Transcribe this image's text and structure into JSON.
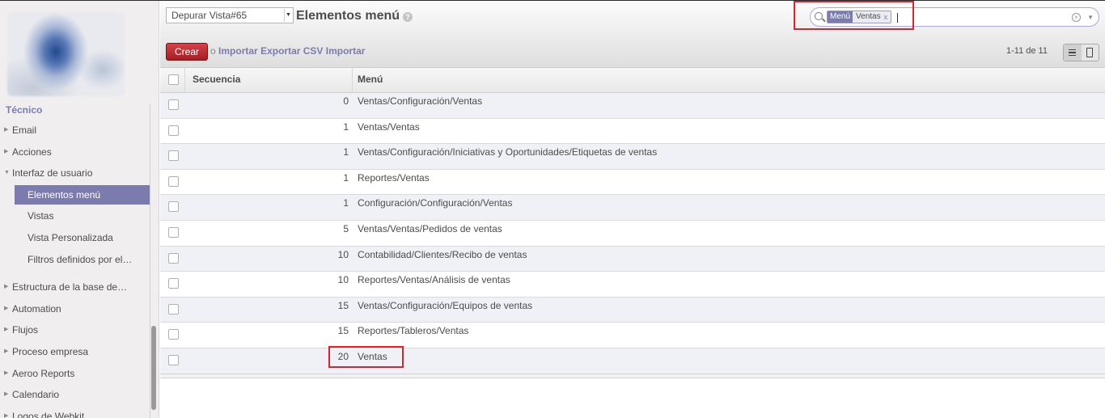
{
  "sidebar": {
    "section_title": "Técnico",
    "items": [
      {
        "label": "Email",
        "level": 0,
        "expanded": false,
        "active": false
      },
      {
        "label": "Acciones",
        "level": 0,
        "expanded": false,
        "active": false
      },
      {
        "label": "Interfaz de usuario",
        "level": 0,
        "expanded": true,
        "active": false
      },
      {
        "label": "Elementos menú",
        "level": 1,
        "expanded": false,
        "active": true
      },
      {
        "label": "Vistas",
        "level": 1,
        "expanded": false,
        "active": false
      },
      {
        "label": "Vista Personalizada",
        "level": 1,
        "expanded": false,
        "active": false
      },
      {
        "label": "Filtros definidos por el…",
        "level": 1,
        "expanded": false,
        "active": false
      },
      {
        "label": "Estructura de la base de…",
        "level": 0,
        "expanded": false,
        "active": false
      },
      {
        "label": "Automation",
        "level": 0,
        "expanded": false,
        "active": false
      },
      {
        "label": "Flujos",
        "level": 0,
        "expanded": false,
        "active": false
      },
      {
        "label": "Proceso empresa",
        "level": 0,
        "expanded": false,
        "active": false
      },
      {
        "label": "Aeroo Reports",
        "level": 0,
        "expanded": false,
        "active": false
      },
      {
        "label": "Calendario",
        "level": 0,
        "expanded": false,
        "active": false
      },
      {
        "label": "Logos de Webkit",
        "level": 0,
        "expanded": false,
        "active": false
      }
    ]
  },
  "header": {
    "debug_select": "Depurar Vista#65",
    "title": "Elementos menú",
    "help": "?",
    "search": {
      "facet_category": "Menú",
      "facet_value": "Ventas",
      "facet_close": "x",
      "clear": "×",
      "drawer": "▼"
    },
    "create_label": "Crear",
    "or_label": "o",
    "links": [
      "Importar",
      "Exportar CSV",
      "Importar"
    ],
    "pager": "1-11 de 11"
  },
  "table": {
    "headers": {
      "sequence": "Secuencia",
      "menu": "Menú"
    },
    "rows": [
      {
        "sequence": "0",
        "menu": "Ventas/Configuración/Ventas"
      },
      {
        "sequence": "1",
        "menu": "Ventas/Ventas"
      },
      {
        "sequence": "1",
        "menu": "Ventas/Configuración/Iniciativas y Oportunidades/Etiquetas de ventas"
      },
      {
        "sequence": "1",
        "menu": "Reportes/Ventas"
      },
      {
        "sequence": "1",
        "menu": "Configuración/Configuración/Ventas"
      },
      {
        "sequence": "5",
        "menu": "Ventas/Ventas/Pedidos de ventas"
      },
      {
        "sequence": "10",
        "menu": "Contabilidad/Clientes/Recibo de ventas"
      },
      {
        "sequence": "10",
        "menu": "Reportes/Ventas/Análisis de ventas"
      },
      {
        "sequence": "15",
        "menu": "Ventas/Configuración/Equipos de ventas"
      },
      {
        "sequence": "15",
        "menu": "Reportes/Tableros/Ventas"
      },
      {
        "sequence": "20",
        "menu": "Ventas"
      }
    ]
  },
  "colors": {
    "accent": "#7c7bad",
    "create_button": "#b8262d",
    "highlight": "#e0202a"
  }
}
